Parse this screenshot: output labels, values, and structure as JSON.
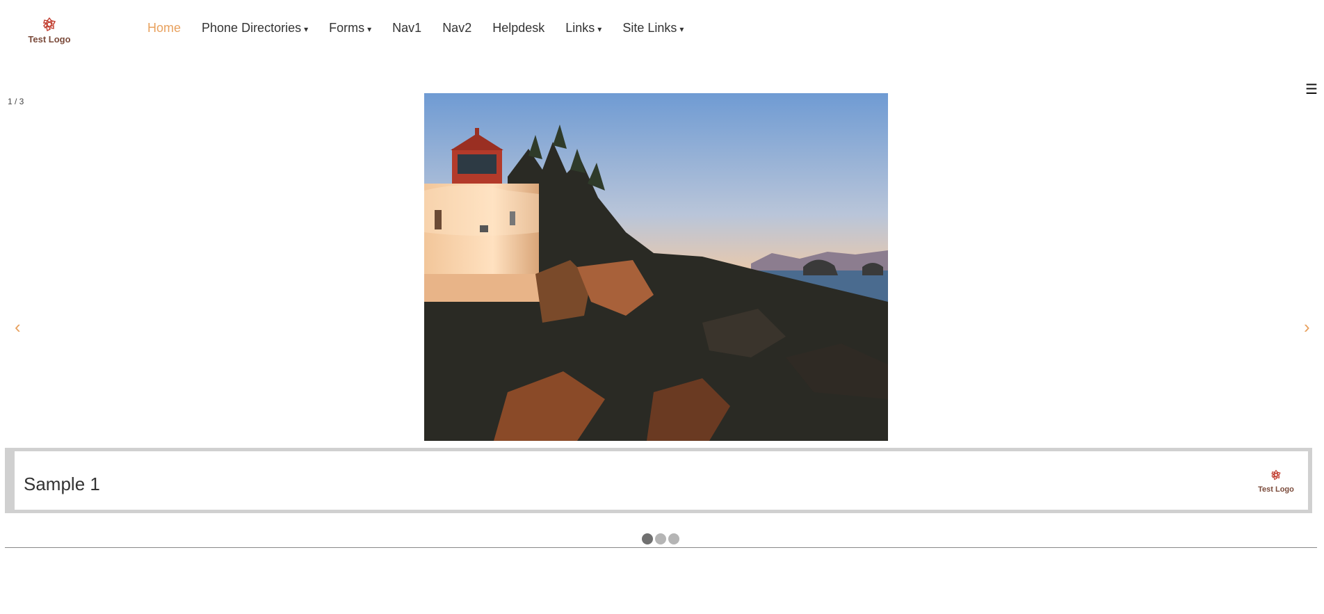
{
  "logo": {
    "text": "Test Logo",
    "color": "#c0392b"
  },
  "nav": {
    "items": [
      {
        "label": "Home",
        "active": true,
        "dropdown": false
      },
      {
        "label": "Phone Directories",
        "dropdown": true
      },
      {
        "label": "Forms",
        "dropdown": true
      },
      {
        "label": "Nav1",
        "dropdown": false
      },
      {
        "label": "Nav2",
        "dropdown": false
      },
      {
        "label": "Helpdesk",
        "dropdown": false
      },
      {
        "label": "Links",
        "dropdown": true
      },
      {
        "label": "Site Links",
        "dropdown": true
      }
    ],
    "caret": "▾",
    "accent_color": "#e8a15e"
  },
  "slideshow": {
    "counter": "1 / 3",
    "prev_arrow": "‹",
    "next_arrow": "›",
    "menu_icon": "☰",
    "caption_title": "Sample 1",
    "caption_logo_text": "Test Logo",
    "image_icon": "lighthouse-image",
    "dots": [
      {
        "active": true
      },
      {
        "active": false
      },
      {
        "active": false
      }
    ]
  }
}
